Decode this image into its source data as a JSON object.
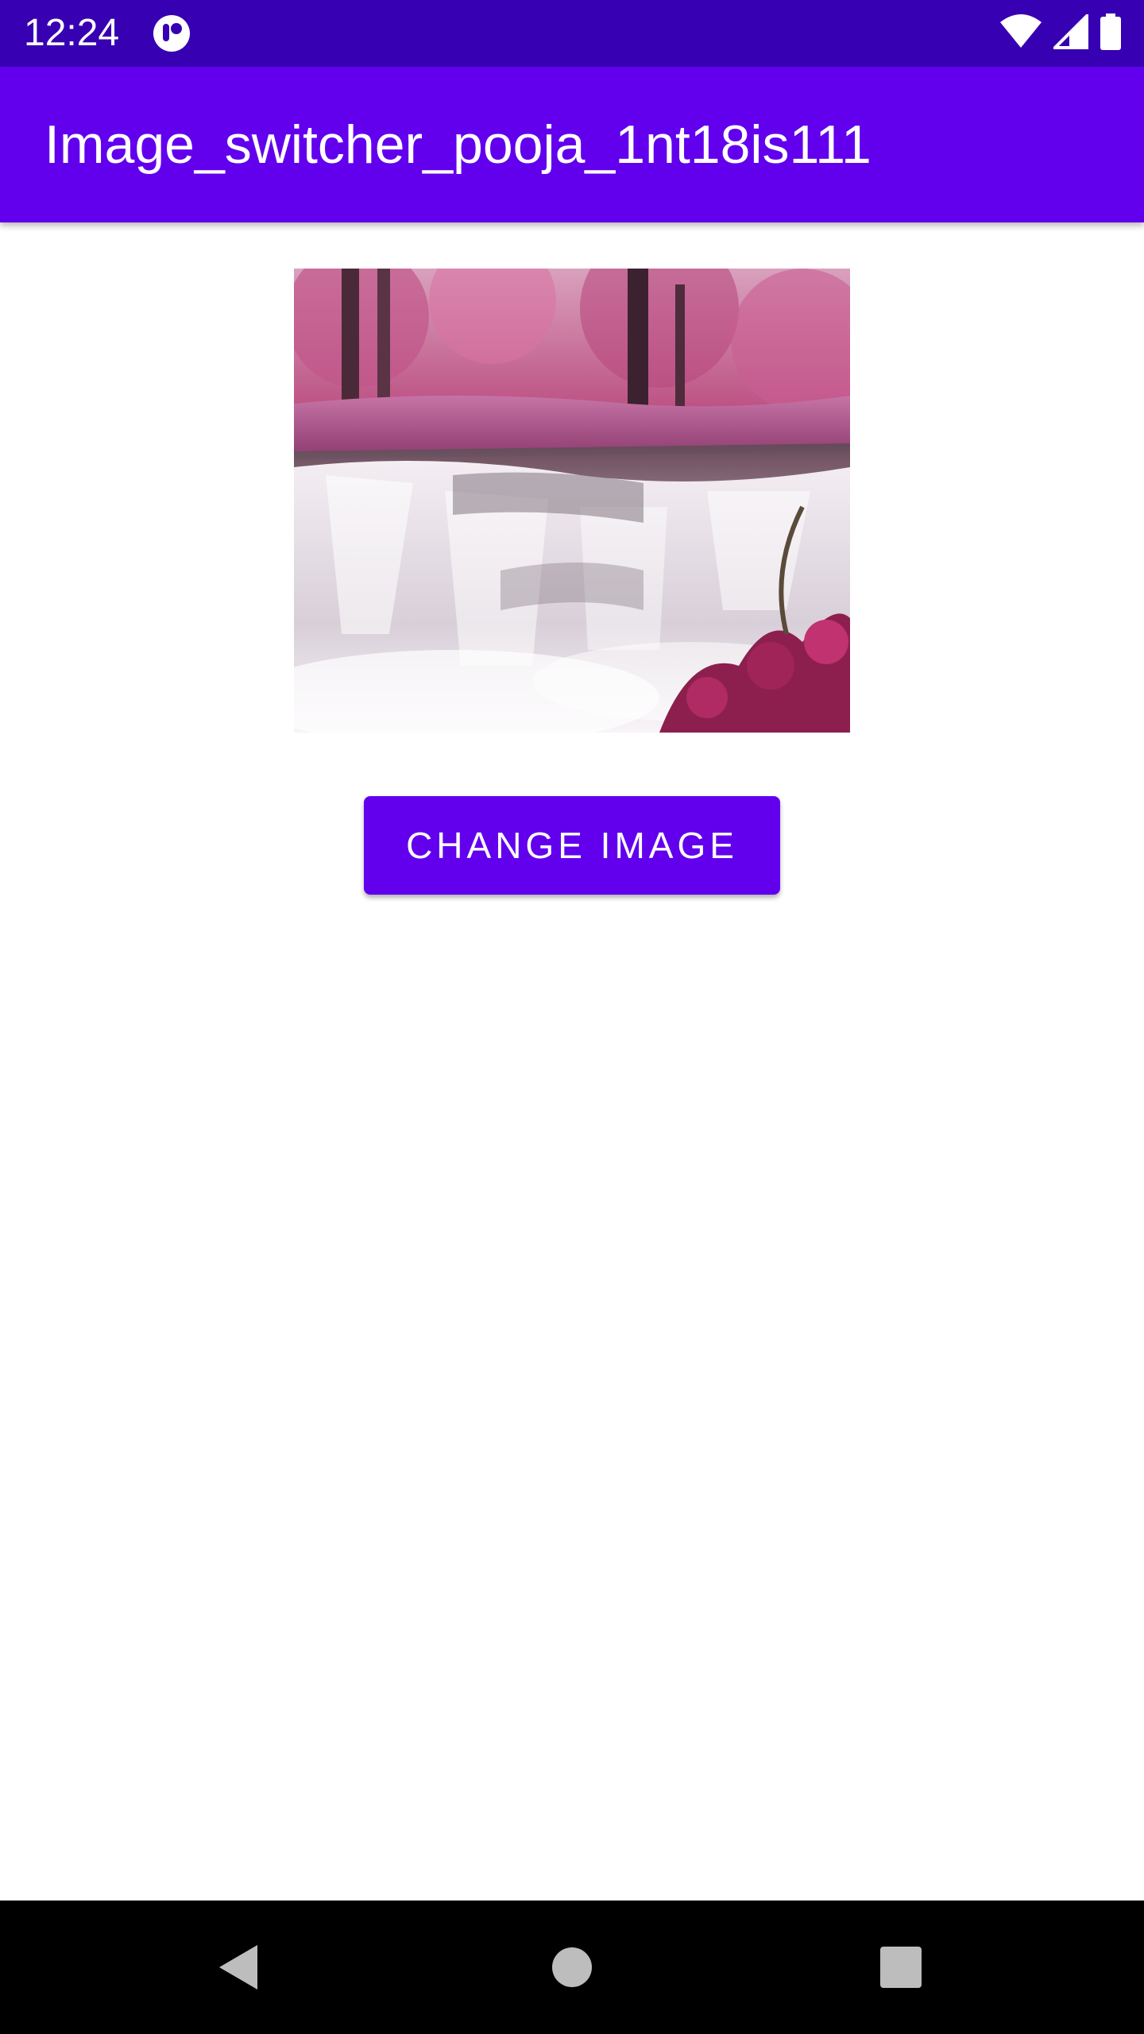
{
  "status_bar": {
    "time": "12:24",
    "icons": [
      "app-notification-icon",
      "wifi-icon",
      "cell-signal-icon",
      "battery-icon"
    ]
  },
  "app_bar": {
    "title": "Image_switcher_pooja_1nt18is111"
  },
  "image_switcher": {
    "image_description_icon": "waterfall-image"
  },
  "button": {
    "label": "CHANGE IMAGE"
  },
  "nav_bar": {
    "icons": [
      "back-icon",
      "home-icon",
      "recents-icon"
    ]
  },
  "colors": {
    "status_bar": "#3700b3",
    "primary": "#6200ee",
    "nav_bar": "#000000",
    "background": "#ffffff"
  }
}
